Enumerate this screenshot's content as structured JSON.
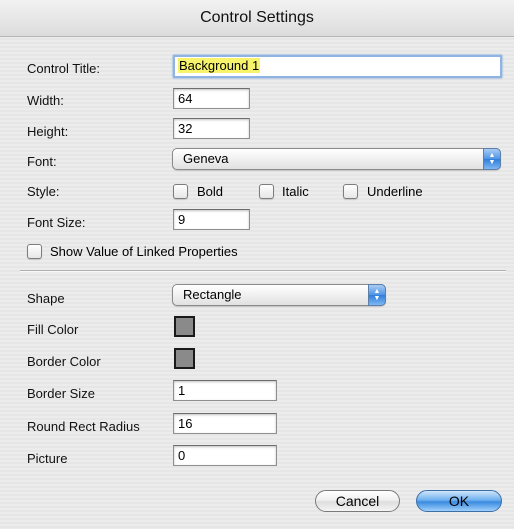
{
  "window": {
    "title": "Control Settings"
  },
  "fields": {
    "control_title": {
      "label": "Control Title:",
      "value": "Background 1"
    },
    "width": {
      "label": "Width:",
      "value": "64"
    },
    "height": {
      "label": "Height:",
      "value": "32"
    },
    "font": {
      "label": "Font:",
      "value": "Geneva"
    },
    "style": {
      "label": "Style:",
      "options": [
        {
          "label": "Bold",
          "checked": false
        },
        {
          "label": "Italic",
          "checked": false
        },
        {
          "label": "Underline",
          "checked": false
        }
      ]
    },
    "font_size": {
      "label": "Font Size:",
      "value": "9"
    },
    "show_linked": {
      "label": "Show Value of Linked Properties",
      "checked": false
    },
    "shape": {
      "label": "Shape",
      "value": "Rectangle"
    },
    "fill_color": {
      "label": "Fill Color",
      "color": "#8a8a8a"
    },
    "border_color": {
      "label": "Border Color",
      "color": "#8a8a8a"
    },
    "border_size": {
      "label": "Border Size",
      "value": "1"
    },
    "round_rect_radius": {
      "label": "Round Rect Radius",
      "value": "16"
    },
    "picture": {
      "label": "Picture",
      "value": "0"
    }
  },
  "buttons": {
    "cancel": "Cancel",
    "ok": "OK"
  },
  "colors": {
    "ok_button": "#3a8be0",
    "title_highlight": "#f7f36b"
  }
}
